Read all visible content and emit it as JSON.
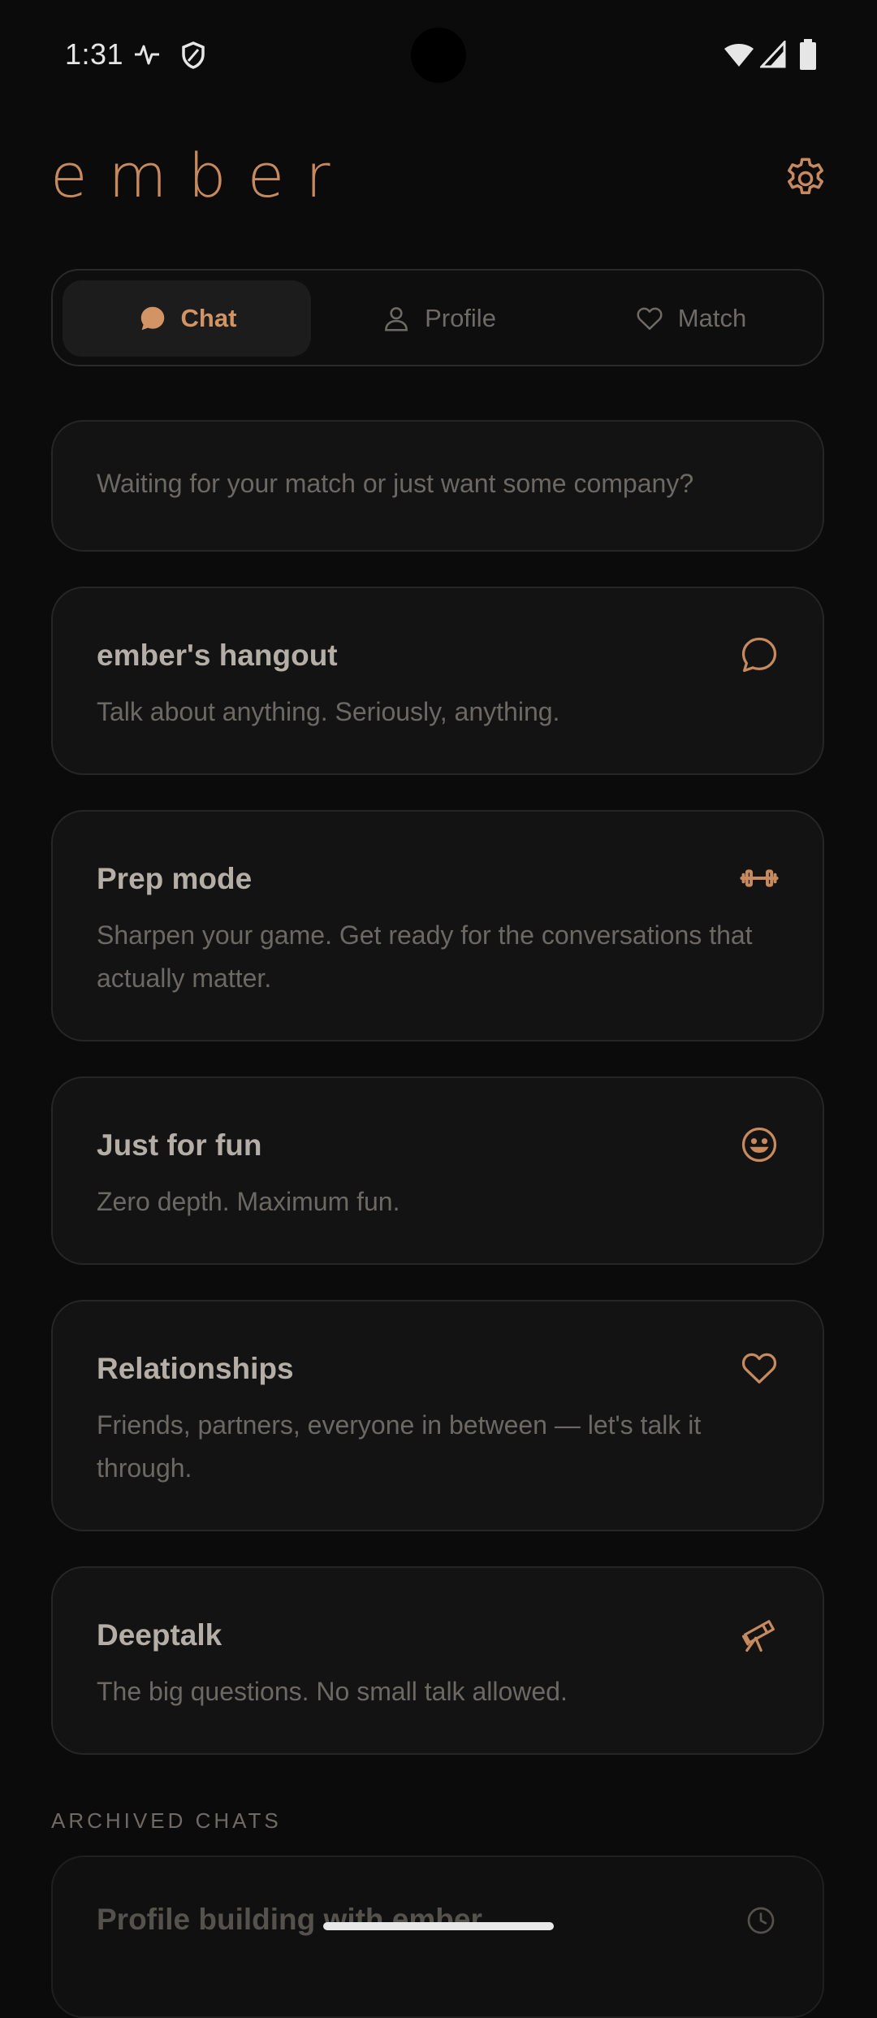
{
  "status_bar": {
    "time": "1:31",
    "icons": [
      "activity-icon",
      "shield-icon",
      "wifi-icon",
      "signal-icon",
      "battery-icon"
    ]
  },
  "app": {
    "logo": "ember",
    "accent_color": "#c78a5e",
    "settings_icon": "gear-icon"
  },
  "tabs": [
    {
      "label": "Chat",
      "icon": "chat-bubble-icon",
      "active": true
    },
    {
      "label": "Profile",
      "icon": "person-icon",
      "active": false
    },
    {
      "label": "Match",
      "icon": "heart-icon",
      "active": false
    }
  ],
  "intro": {
    "text": "Waiting for your match or just want some company?"
  },
  "chats": [
    {
      "title": "ember's hangout",
      "description": "Talk about anything. Seriously, anything.",
      "icon": "chat-bubble-icon"
    },
    {
      "title": "Prep mode",
      "description": "Sharpen your game. Get ready for the conversations that actually matter.",
      "icon": "dumbbell-icon"
    },
    {
      "title": "Just for fun",
      "description": "Zero depth. Maximum fun.",
      "icon": "smiley-icon"
    },
    {
      "title": "Relationships",
      "description": "Friends, partners, everyone in between — let's talk it through.",
      "icon": "heart-icon"
    },
    {
      "title": "Deeptalk",
      "description": "The big questions. No small talk allowed.",
      "icon": "telescope-icon"
    }
  ],
  "archived": {
    "label": "ARCHIVED CHATS",
    "items": [
      {
        "title": "Profile building with ember",
        "icon": "clock-icon"
      }
    ]
  }
}
